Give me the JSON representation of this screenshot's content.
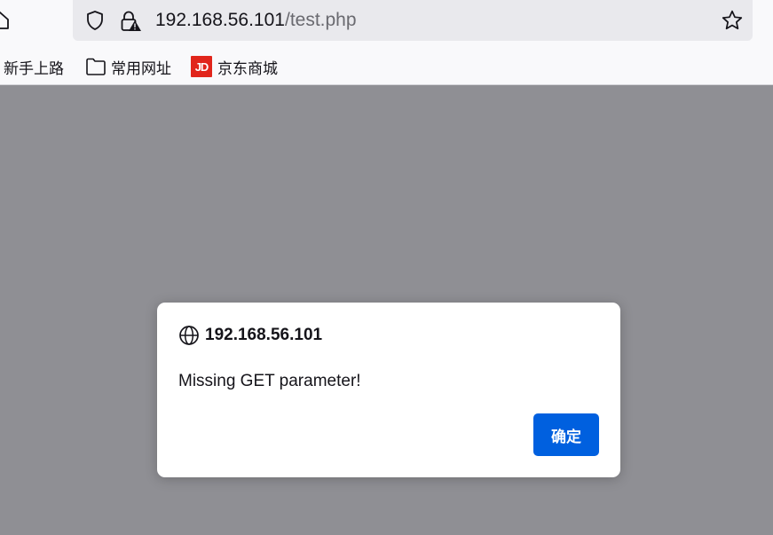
{
  "address_bar": {
    "host": "192.168.56.101",
    "path": "/test.php"
  },
  "bookmarks": [
    {
      "label": "新手上路",
      "icon": "none"
    },
    {
      "label": "常用网址",
      "icon": "folder-icon"
    },
    {
      "label": "京东商城",
      "icon": "jd-favicon",
      "favicon_text": "JD"
    }
  ],
  "dialog": {
    "origin": "192.168.56.101",
    "message": "Missing GET parameter!",
    "ok_label": "确定"
  },
  "colors": {
    "accent_button": "#0060df",
    "overlay": "#8f8f94",
    "jd_brand": "#e1251b"
  }
}
